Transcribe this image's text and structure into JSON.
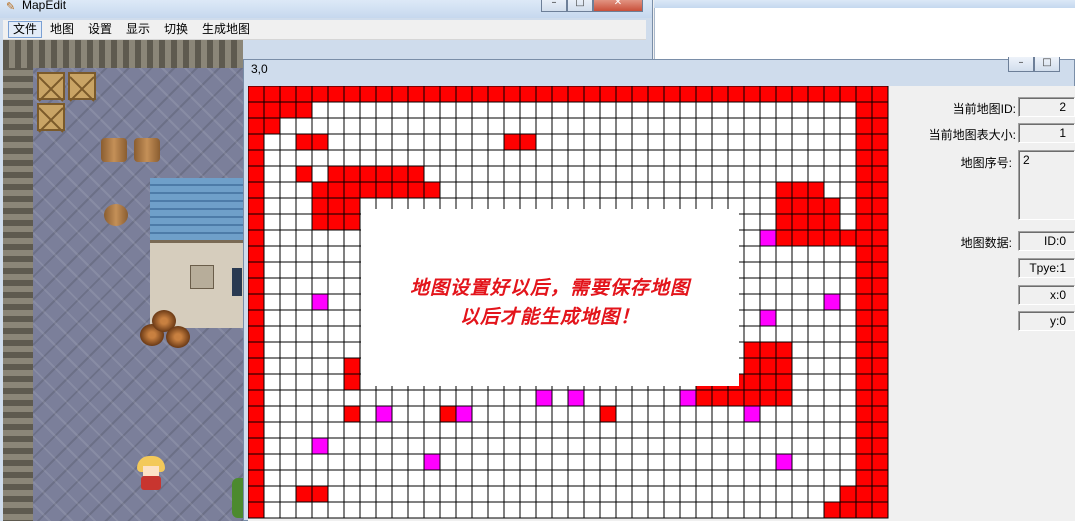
{
  "main_window": {
    "title": "MapEdit",
    "menu": [
      "文件",
      "地图",
      "设置",
      "显示",
      "切换",
      "生成地图"
    ]
  },
  "editor_window": {
    "title": "3,0"
  },
  "overlay": {
    "line1": "地图设置好以后，需要保存地图",
    "line2": "以后才能生成地图！"
  },
  "info_panel": {
    "current_map_id_label": "当前地图ID:",
    "current_map_id_value": "2",
    "current_map_size_label": "当前地图表大小:",
    "current_map_size_value": "1",
    "map_index_label": "地图序号:",
    "map_index_value": "2",
    "map_data_label": "地图数据:",
    "id_value": "ID:0",
    "type_value": "Tpye:1",
    "x_value": "x:0",
    "y_value": "y:0"
  },
  "colors": {
    "cell_red": "#ff0000",
    "cell_magenta": "#ff00ff",
    "cell_white": "#ffffff",
    "overlay_text": "#e3141b"
  },
  "icons": {
    "app": "pen-icon",
    "minimize": "minimize-icon",
    "maximize": "maximize-icon",
    "close": "close-icon"
  }
}
